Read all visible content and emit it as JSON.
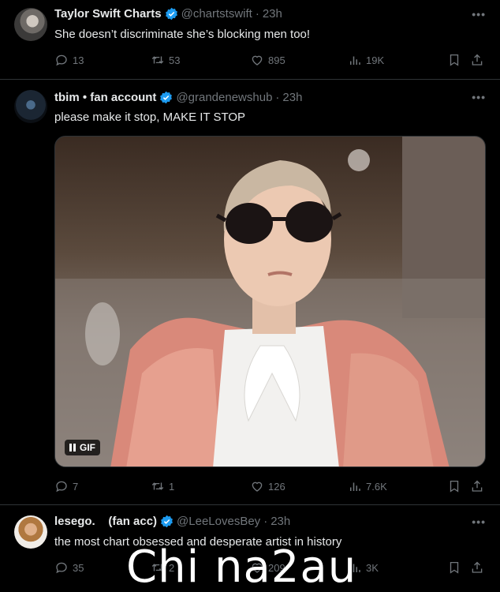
{
  "tweets": [
    {
      "name": "Taylor Swift Charts",
      "handle": "@chartstswift",
      "time": "23h",
      "text": "She doesn’t discriminate she’s blocking men too!",
      "replies": "13",
      "retweets": "53",
      "likes": "895",
      "views": "19K"
    },
    {
      "name": "tbim • fan account",
      "handle": "@grandenewshub",
      "time": "23h",
      "text": "please make it stop, MAKE IT STOP",
      "media_badge": "GIF",
      "replies": "7",
      "retweets": "1",
      "likes": "126",
      "views": "7.6K"
    },
    {
      "name": "lesego.    (fan acc)",
      "handle": "@LeeLovesBey",
      "time": "23h",
      "text": "the most chart obsessed and desperate artist in history",
      "replies": "35",
      "retweets": "2",
      "likes": "209",
      "views": "3K"
    }
  ],
  "separator": "·",
  "more_label": "•••",
  "watermark": "Chi na2au",
  "colors": {
    "background": "#000000",
    "text": "#e7e9ea",
    "muted": "#71767b",
    "verified": "#1d9bf0",
    "divider": "#2f3336"
  },
  "icons": [
    "reply-icon",
    "retweet-icon",
    "like-icon",
    "views-icon",
    "bookmark-icon",
    "share-icon",
    "verified-badge-icon",
    "pause-icon"
  ]
}
